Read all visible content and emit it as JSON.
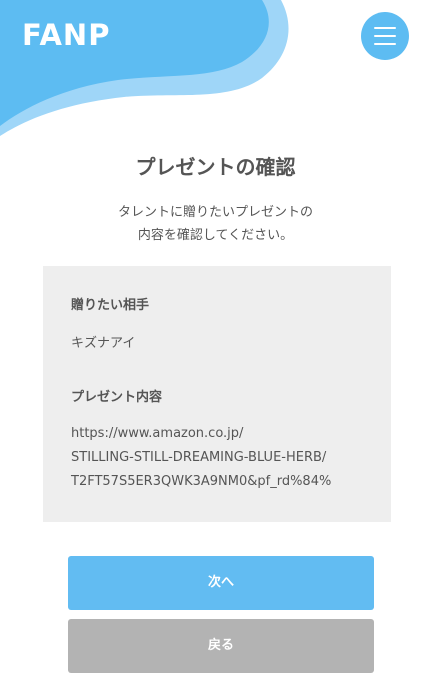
{
  "header": {
    "logo_text": "FANP",
    "menu_icon": "hamburger-menu-icon",
    "colors": {
      "wave_light": "#9fd6f8",
      "wave_main": "#5dbcf2",
      "menu_button": "#5dbcf2"
    }
  },
  "page": {
    "title": "プレゼントの確認",
    "description_lines": [
      "タレントに贈りたいプレゼントの",
      "内容を確認してください。"
    ]
  },
  "card": {
    "recipient_label": "贈りたい相手",
    "recipient_value": "キズナアイ",
    "present_label": "プレゼント内容",
    "present_url_lines": [
      "https://www.amazon.co.jp/",
      "STILLING-STILL-DREAMING-BLUE-HERB/",
      "T2FT57S5ER3QWK3A9NM0&pf_rd%84%"
    ],
    "background": "#eeeeee"
  },
  "buttons": {
    "next_label": "次へ",
    "back_label": "戻る",
    "next_color": "#62bcf2",
    "back_color": "#b3b3b3"
  }
}
